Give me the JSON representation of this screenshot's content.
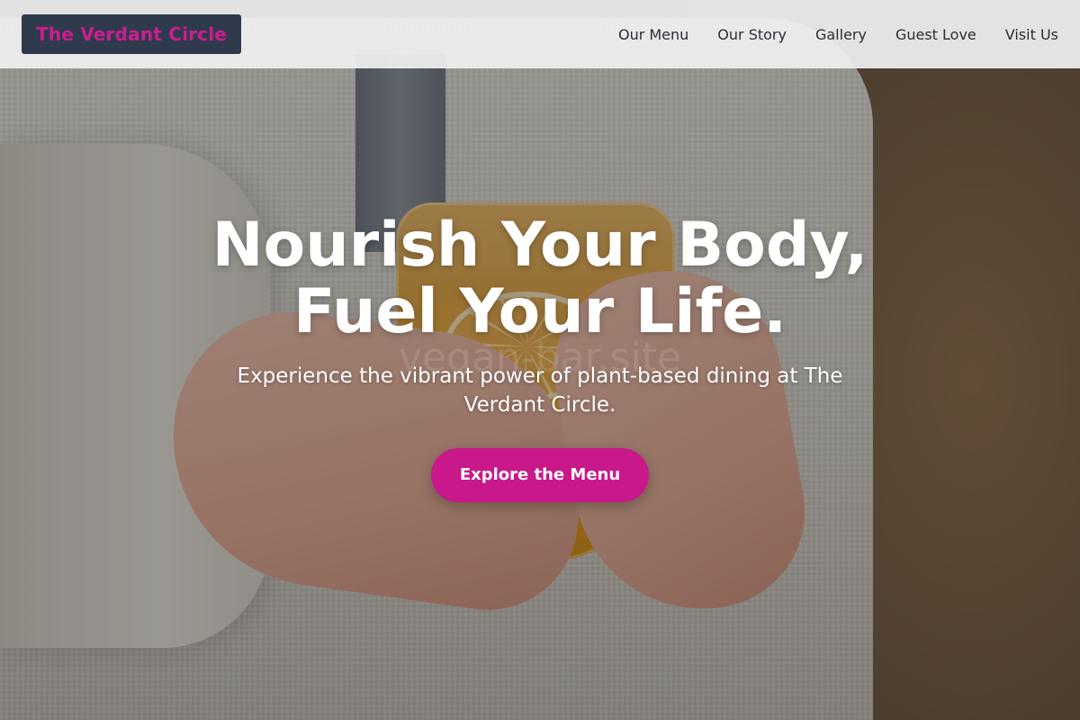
{
  "header": {
    "brand": "The Verdant Circle",
    "nav": [
      {
        "label": "Our Menu"
      },
      {
        "label": "Our Story"
      },
      {
        "label": "Gallery"
      },
      {
        "label": "Guest Love"
      },
      {
        "label": "Visit Us"
      }
    ]
  },
  "hero": {
    "title_line_1": "Nourish Your Body,",
    "title_line_2": "Fuel Your Life.",
    "subtitle": "Experience the vibrant power of plant-based dining at The Verdant Circle.",
    "cta_label": "Explore the Menu",
    "watermark": "vegan-bar.site"
  },
  "colors": {
    "brand_pink": "#c8188a",
    "logo_bg": "#2f3a4d",
    "header_bg": "#f0f0f0"
  }
}
